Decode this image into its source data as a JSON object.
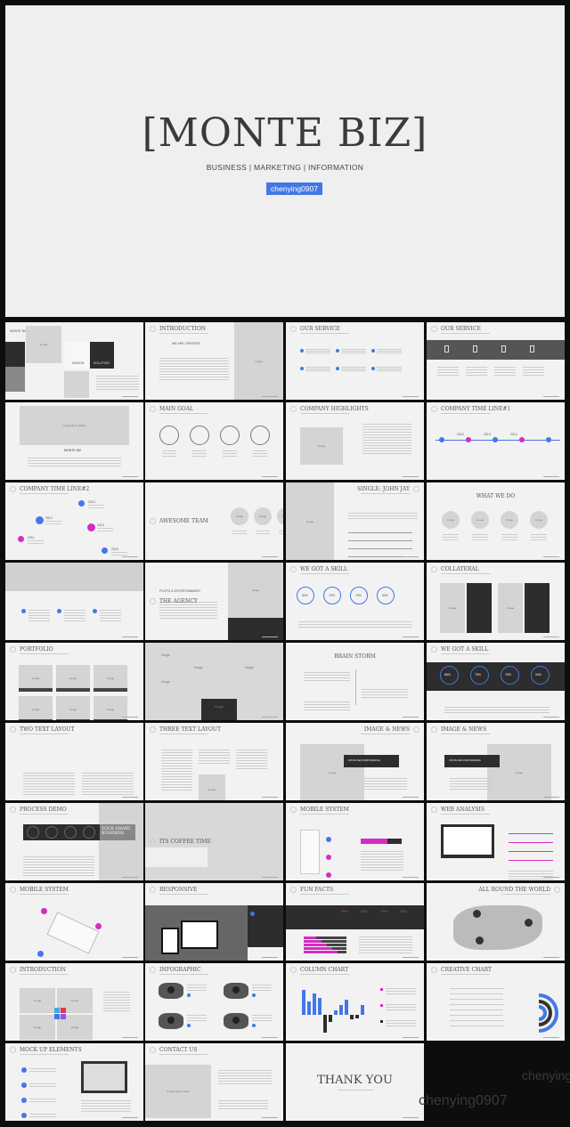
{
  "hero": {
    "title": "[MONTE BIZ]",
    "subtitle": "BUSINESS | MARKETING | INFORMATION",
    "badge": "chenying0907",
    "accent": "#4477e6"
  },
  "colors": {
    "blue": "#4477e6",
    "magenta": "#d42cc0",
    "dark": "#2d2d2d",
    "placeholder": "#d4d4d4"
  },
  "slides": [
    {
      "title": "",
      "layout": "collage-cover",
      "labels": [
        "MONTE BIZ",
        "Image",
        "DESIGN",
        "SOLUTION"
      ]
    },
    {
      "title": "INTRODUCTION",
      "kicker": "WE ARE CREATIVE",
      "layout": "image-right",
      "labels": [
        "Image"
      ]
    },
    {
      "title": "OUR SERVICE",
      "layout": "service-dots"
    },
    {
      "title": "OUR SERVICE",
      "layout": "dark-band-icons"
    },
    {
      "title": "",
      "layout": "image-top",
      "labels": [
        "Image Place Holder",
        "MONTE BIZ"
      ]
    },
    {
      "title": "MAIN GOAL",
      "layout": "rings4"
    },
    {
      "title": "COMPANY HIGHLIGHTS",
      "layout": "image-left-inset",
      "labels": [
        "Image"
      ]
    },
    {
      "title": "COMPANY TIME LINE#1",
      "layout": "timeline1",
      "labels": [
        "2012",
        "2013",
        "2014"
      ]
    },
    {
      "title": "COMPANY TIME LINE#2",
      "layout": "timeline2",
      "labels": [
        "2011",
        "2012",
        "2013",
        "2014",
        "2015"
      ]
    },
    {
      "title": "AWESOME TEAM",
      "layout": "team3",
      "align": "mid",
      "labels": [
        "Image",
        "Image",
        "Image"
      ]
    },
    {
      "title": "SINGLE: JOHN JAY",
      "align": "right",
      "layout": "image-left-bars",
      "labels": [
        "Image"
      ]
    },
    {
      "title": "WHAT WE DO",
      "align": "center",
      "layout": "circles4",
      "labels": [
        "Image",
        "Image",
        "Image",
        "Image"
      ]
    },
    {
      "title": "",
      "layout": "gray-top-dots"
    },
    {
      "title": "THE AGENCY",
      "kicker": "PHOTO & ENTERTAINMENT",
      "align": "mid",
      "layout": "agency",
      "labels": [
        "Image"
      ]
    },
    {
      "title": "WE GOT A SKILL",
      "layout": "skill-light",
      "labels": [
        "50%",
        "75%",
        "75%",
        "50%"
      ]
    },
    {
      "title": "COLLATERAL",
      "layout": "collateral",
      "labels": [
        "Image",
        "Image"
      ]
    },
    {
      "title": "PORTFOLIO",
      "layout": "grid6",
      "labels": [
        "Image",
        "Image",
        "Image",
        "Image",
        "Image",
        "Image"
      ]
    },
    {
      "title": "",
      "layout": "photo-collage",
      "labels": [
        "Image",
        "Image",
        "Image",
        "Image",
        "Image"
      ]
    },
    {
      "title": "BRAIN STORM",
      "align": "center",
      "layout": "brainstorm"
    },
    {
      "title": "WE GOT A SKILL",
      "layout": "skill-dark",
      "labels": [
        "85%",
        "75%",
        "78%",
        "90%"
      ]
    },
    {
      "title": "TWO TEXT LAYOUT",
      "layout": "text2"
    },
    {
      "title": "THREE TEXT LAYOUT",
      "layout": "text3",
      "labels": [
        "Image"
      ]
    },
    {
      "title": "IMAGE & NEWS",
      "align": "right",
      "layout": "news-left",
      "labels": [
        "Image",
        "OFFICE NEW PERFORMANCE"
      ]
    },
    {
      "title": "IMAGE & NEWS",
      "layout": "news-right",
      "labels": [
        "Image",
        "OFFICE NEW PERFORMANCE"
      ]
    },
    {
      "title": "PROCESS DEMO",
      "layout": "process",
      "labels": [
        "YOUR SMART BUSINESS"
      ]
    },
    {
      "title": "ITS COFFEE TIME",
      "layout": "coffee",
      "align": "mid"
    },
    {
      "title": "MOBILE SYSTEM",
      "layout": "mobile1"
    },
    {
      "title": "WEB ANALYSIS",
      "layout": "web"
    },
    {
      "title": "MOBILE SYSTEM",
      "layout": "mobile2"
    },
    {
      "title": "RESPONSIVE",
      "layout": "responsive"
    },
    {
      "title": "FUN FACTS",
      "layout": "funfacts",
      "labels": [
        "65%",
        "25%",
        "19%",
        "24%"
      ]
    },
    {
      "title": "ALL ROUND THE WORLD",
      "align": "right",
      "layout": "world"
    },
    {
      "title": "INTRODUCTION",
      "layout": "intro-grid",
      "labels": [
        "Image",
        "Image",
        "Image",
        "Image"
      ]
    },
    {
      "title": "INFOGRAPHIC",
      "layout": "infographic"
    },
    {
      "title": "COLUMN CHART",
      "layout": "columns"
    },
    {
      "title": "CREATIVE CHART",
      "layout": "creative"
    },
    {
      "title": "MOCK UP ELEMENTS",
      "layout": "mockup"
    },
    {
      "title": "CONTACT US",
      "layout": "contact",
      "labels": [
        "Image Place Holder"
      ]
    },
    {
      "title": "THANK YOU",
      "layout": "thanks"
    }
  ],
  "watermark": "chenying0907"
}
